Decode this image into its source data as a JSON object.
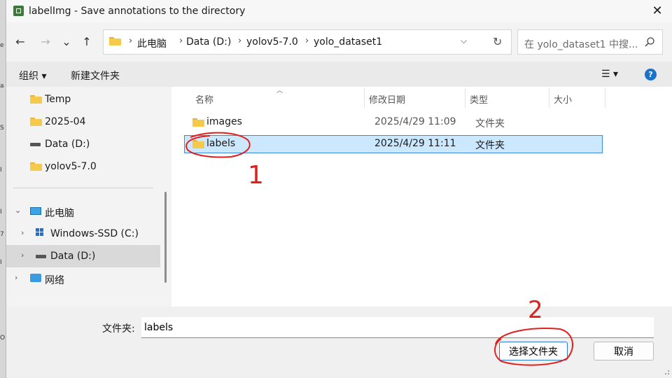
{
  "window": {
    "title": "labelImg - Save annotations to the directory",
    "close_label": "✕"
  },
  "nav_buttons": {
    "back": "←",
    "forward": "→",
    "recent": "⌄",
    "up": "↑"
  },
  "address": {
    "crumbs": [
      "此电脑",
      "Data (D:)",
      "yolov5-7.0",
      "yolo_dataset1"
    ],
    "sep": "›",
    "dropdown": "⌵",
    "refresh": "↻"
  },
  "search": {
    "placeholder": "在 yolo_dataset1 中搜..."
  },
  "commandbar": {
    "organize": "组织 ▾",
    "new_folder": "新建文件夹",
    "view": "☰ ▾",
    "help": "?"
  },
  "nav": {
    "items": [
      {
        "label": "Temp"
      },
      {
        "label": "2025-04"
      },
      {
        "label": "Data (D:)"
      },
      {
        "label": "yolov5-7.0"
      },
      {
        "label": "此电脑",
        "chevron": "⌄"
      },
      {
        "label": "Windows-SSD (C:)",
        "chevron": "›"
      },
      {
        "label": "Data (D:)",
        "chevron": "›"
      },
      {
        "label": "网络",
        "chevron": "›"
      }
    ]
  },
  "columns": {
    "name": "名称",
    "date": "修改日期",
    "type": "类型",
    "size": "大小",
    "sort": "︿"
  },
  "rows": [
    {
      "name": "images",
      "date": "2025/4/29 11:09",
      "type": "文件夹"
    },
    {
      "name": "labels",
      "date": "2025/4/29 11:11",
      "type": "文件夹"
    }
  ],
  "footer": {
    "folder_label": "文件夹:",
    "folder_value": "labels",
    "select_button": "选择文件夹",
    "cancel_button": "取消"
  },
  "annotations": {
    "mark1": "1",
    "mark2": "2"
  },
  "background_chars": [
    "e",
    "a",
    "S",
    "I",
    "I",
    "7",
    "I",
    "O"
  ],
  "colors": {
    "accent": "#0067c0",
    "selection": "#cce8ff",
    "annotation": "#e0201c"
  }
}
